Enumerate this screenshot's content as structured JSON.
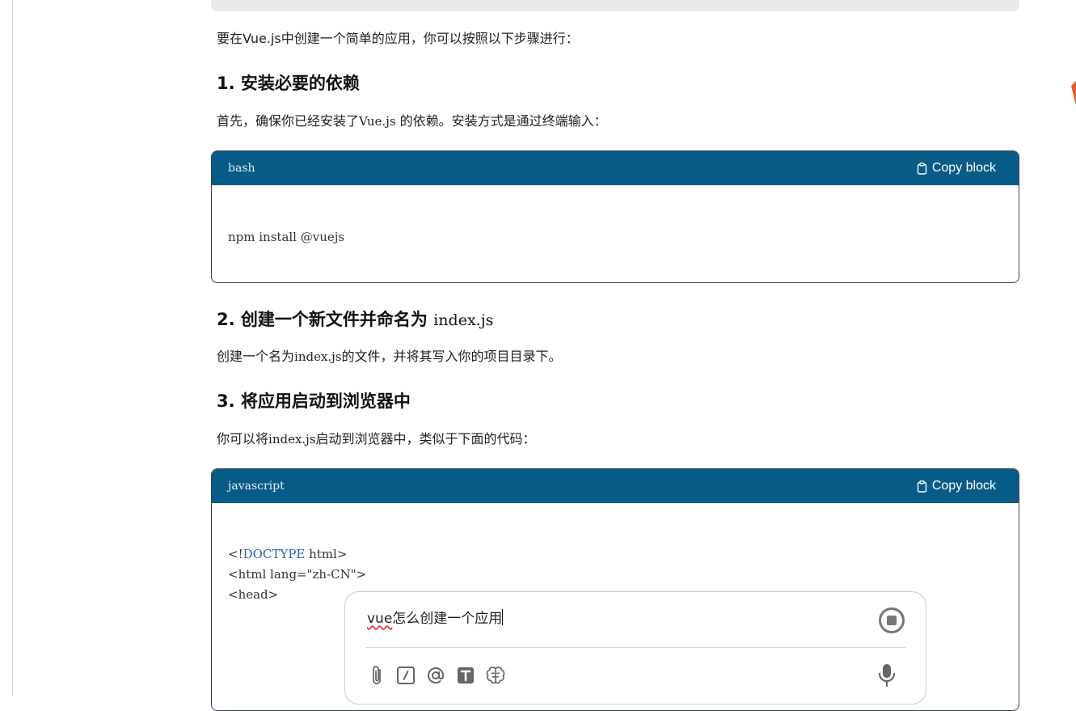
{
  "intro": "要在Vue.js中创建一个简单的应用，你可以按照以下步骤进行：",
  "step1": {
    "heading": "1. 安装必要的依赖",
    "text_before": "首先，确保你已经安装了",
    "code": "Vue.js",
    "text_after": " 的依赖。安装方式是通过终端输入："
  },
  "code_block_1": {
    "language": "bash",
    "copy_label": "Copy block",
    "line": "npm install @vuejs"
  },
  "step2": {
    "heading": "2. 创建一个新文件并命名为 ",
    "heading_code": "index.js",
    "text_before": "创建一个名为",
    "code": "index.js",
    "text_after": "的文件，并将其写入你的项目目录下。"
  },
  "step3": {
    "heading": "3. 将应用启动到浏览器中",
    "text_before": "你可以将",
    "code": "index.js",
    "text_after": "启动到浏览器中，类似于下面的代码："
  },
  "code_block_2": {
    "language": "javascript",
    "copy_label": "Copy block",
    "line1_open": "<!",
    "line1_kw": "DOCTYPE",
    "line1_rest": " html>",
    "line2": "<html lang=\"zh-CN\">",
    "line3": "<head>"
  },
  "chat_input": {
    "value_spell": "vue",
    "value_rest": "怎么创建一个应用"
  },
  "icons": [
    "clipboard-icon",
    "attach-icon",
    "slash-command-icon",
    "mention-icon",
    "text-format-icon",
    "brain-icon",
    "mic-icon",
    "stop-icon"
  ],
  "colors": {
    "code_header": "#075c87",
    "accent": "#f05a28"
  }
}
